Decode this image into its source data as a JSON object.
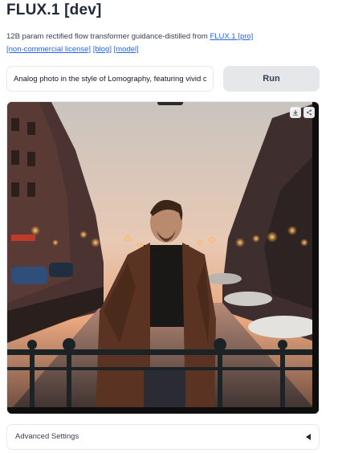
{
  "header": {
    "title": "FLUX.1 [dev]"
  },
  "description": {
    "text": "12B param rectified flow transformer guidance-distilled from ",
    "links": [
      {
        "label": "FLUX.1 [pro]"
      },
      {
        "label": "[non-commercial license]"
      },
      {
        "label": "[blog]"
      },
      {
        "label": "[model]"
      }
    ]
  },
  "prompt": {
    "value": "Analog photo in the style of Lomography, featuring vivid colors"
  },
  "run_button": {
    "label": "Run"
  },
  "result": {
    "toolbar": [
      {
        "icon": "download-icon"
      },
      {
        "icon": "share-icon"
      }
    ]
  },
  "advanced": {
    "label": "Advanced Settings",
    "icon": "caret-left-icon"
  },
  "colors": {
    "accent_link": "#2563eb",
    "button_bg": "#e5e7eb",
    "border": "#e5e7eb"
  }
}
